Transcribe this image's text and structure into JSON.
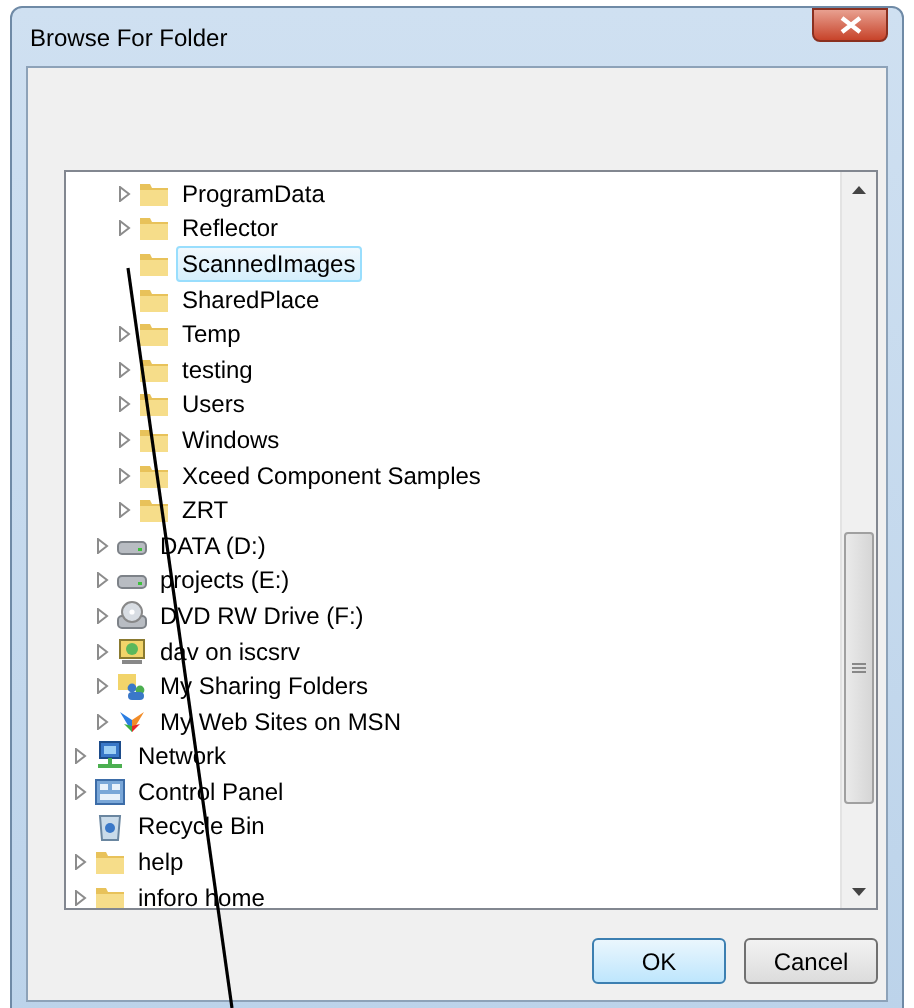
{
  "window": {
    "title": "Browse For Folder"
  },
  "tree": {
    "items": [
      {
        "children": [
          {
            "children": [
              {
                "label": "ProgramData",
                "kind": "folder",
                "expandable": true,
                "selected": false
              },
              {
                "label": "Reflector",
                "kind": "folder",
                "expandable": true,
                "selected": false
              },
              {
                "label": "ScannedImages",
                "kind": "folder",
                "expandable": false,
                "selected": true
              },
              {
                "label": "SharedPlace",
                "kind": "folder",
                "expandable": false,
                "selected": false
              },
              {
                "label": "Temp",
                "kind": "folder",
                "expandable": true,
                "selected": false
              },
              {
                "label": "testing",
                "kind": "folder",
                "expandable": true,
                "selected": false
              },
              {
                "label": "Users",
                "kind": "folder",
                "expandable": true,
                "selected": false
              },
              {
                "label": "Windows",
                "kind": "folder",
                "expandable": true,
                "selected": false
              },
              {
                "label": "Xceed Component Samples",
                "kind": "folder",
                "expandable": true,
                "selected": false
              },
              {
                "label": "ZRT",
                "kind": "folder",
                "expandable": true,
                "selected": false
              }
            ]
          },
          {
            "label": "DATA (D:)",
            "kind": "drive",
            "expandable": true,
            "selected": false
          },
          {
            "label": "projects (E:)",
            "kind": "drive",
            "expandable": true,
            "selected": false
          },
          {
            "label": "DVD RW Drive (F:)",
            "kind": "dvd",
            "expandable": true,
            "selected": false
          },
          {
            "label": "dav on iscsrv",
            "kind": "network-drive",
            "expandable": true,
            "selected": false
          },
          {
            "label": "My Sharing Folders",
            "kind": "sharing",
            "expandable": true,
            "selected": false
          },
          {
            "label": "My Web Sites on MSN",
            "kind": "msn",
            "expandable": true,
            "selected": false
          }
        ]
      },
      {
        "label": "Network",
        "kind": "network",
        "expandable": true,
        "selected": false
      },
      {
        "label": "Control Panel",
        "kind": "control-panel",
        "expandable": true,
        "selected": false
      },
      {
        "label": "Recycle Bin",
        "kind": "recycle-bin",
        "expandable": false,
        "selected": false
      },
      {
        "label": "help",
        "kind": "folder",
        "expandable": true,
        "selected": false
      },
      {
        "label": "inforo home",
        "kind": "folder",
        "expandable": true,
        "selected": false
      }
    ]
  },
  "buttons": [
    {
      "label": "OK",
      "default": true
    },
    {
      "label": "Cancel",
      "default": false
    }
  ]
}
